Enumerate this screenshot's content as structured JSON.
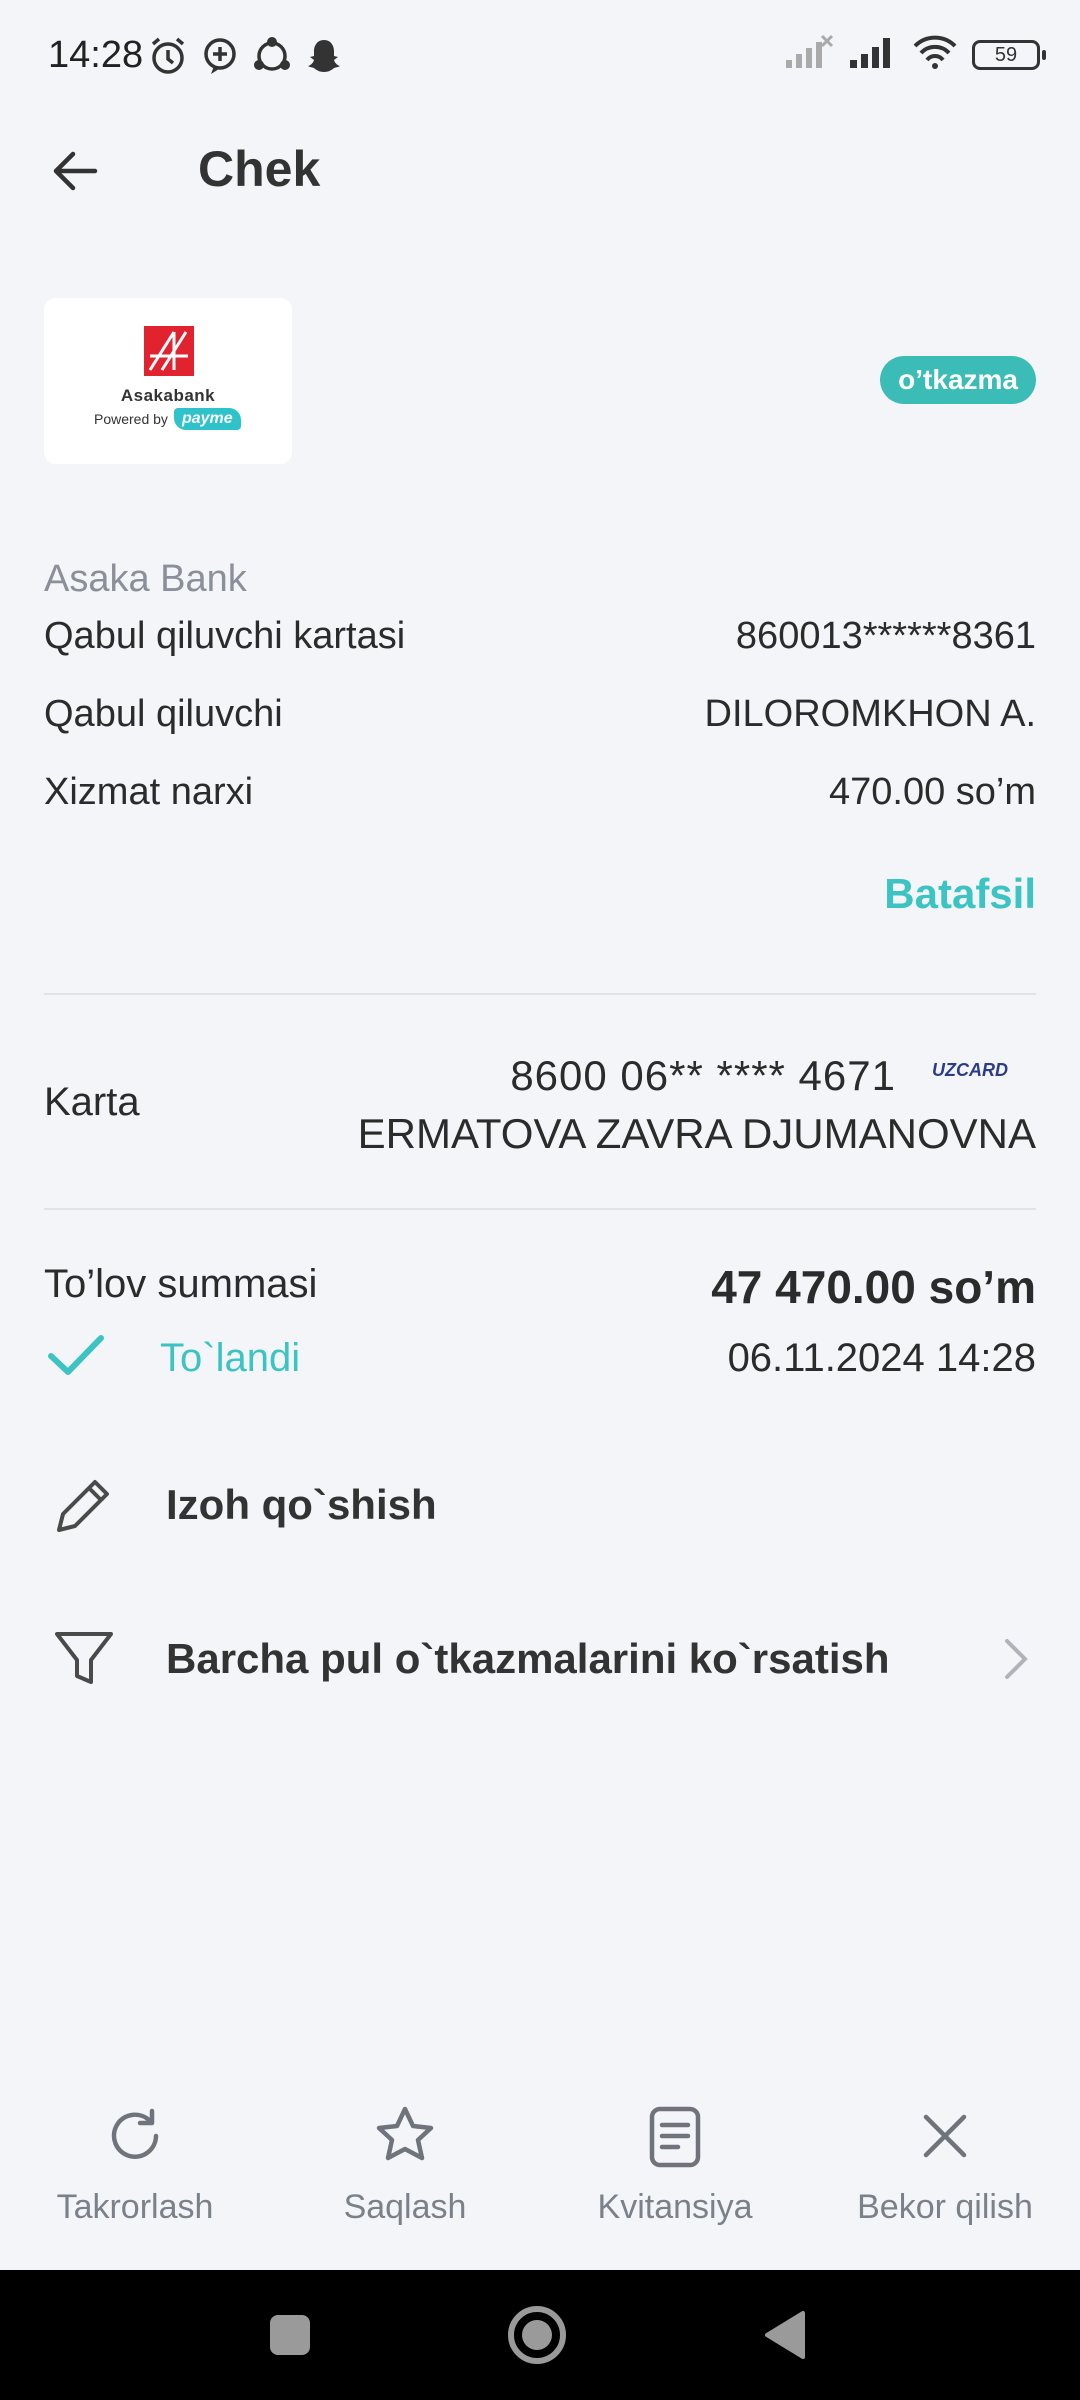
{
  "status_bar": {
    "time": "14:28",
    "battery": "59",
    "left_icons": [
      "alarm-icon",
      "message-plus-icon",
      "sync-icon",
      "snapchat-icon"
    ],
    "right_icons": [
      "no-signal-icon",
      "signal-icon",
      "wifi-icon",
      "battery-icon"
    ]
  },
  "header": {
    "title": "Chek",
    "back_icon": "arrow-left-icon"
  },
  "merchant": {
    "logo_name": "Asakabank",
    "powered_by": "Powered by",
    "payme": "payme",
    "tag": "o’tkazma",
    "tag_color": "#3bbcb7"
  },
  "details": {
    "bank_name": "Asaka Bank",
    "rows": [
      {
        "label": "Qabul qiluvchi kartasi",
        "value": "860013******8361"
      },
      {
        "label": "Qabul qiluvchi",
        "value": "DILOROMKHON A."
      },
      {
        "label": "Xizmat narxi",
        "value": "470.00 so’m"
      }
    ],
    "more_link": "Batafsil"
  },
  "card": {
    "label": "Karta",
    "number": "8600 06** **** 4671",
    "brand": "UZCARD",
    "owner": "ERMATOVA ZAVRA DJUMANOVNA"
  },
  "payment": {
    "label": "To’lov summasi",
    "amount": "47 470.00 so’m",
    "status": "To`landi",
    "date": "06.11.2024 14:28",
    "accent_color": "#3cc3c3"
  },
  "actions": [
    {
      "icon": "pencil-icon",
      "label": "Izoh qo`shish"
    },
    {
      "icon": "filter-icon",
      "label": "Barcha pul o`tkazmalarini ko`rsatish"
    }
  ],
  "bottom_tabs": [
    {
      "icon": "refresh-icon",
      "label": "Takrorlash"
    },
    {
      "icon": "star-icon",
      "label": "Saqlash"
    },
    {
      "icon": "receipt-icon",
      "label": "Kvitansiya"
    },
    {
      "icon": "close-icon",
      "label": "Bekor qilish"
    }
  ]
}
